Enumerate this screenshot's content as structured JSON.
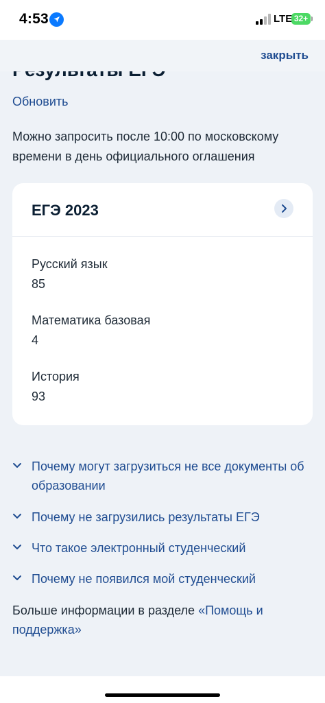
{
  "status_bar": {
    "time": "4:53",
    "network": "LTE",
    "battery": "32+",
    "icons": [
      "location-arrow-icon",
      "signal-icon",
      "battery-icon"
    ]
  },
  "nav": {
    "close_label": "закрыть"
  },
  "header": {
    "title": "Результаты ЕГЭ",
    "refresh_label": "Обновить"
  },
  "note": "Можно запросить после 10:00 по московскому времени в день официального оглашения",
  "exam_card": {
    "title": "ЕГЭ 2023",
    "subjects": [
      {
        "name": "Русский язык",
        "score": "85"
      },
      {
        "name": "Математика базовая",
        "score": "4"
      },
      {
        "name": "История",
        "score": "93"
      }
    ]
  },
  "faq": [
    {
      "question": "Почему могут загрузиться не все документы об образовании"
    },
    {
      "question": "Почему не загрузились результаты ЕГЭ"
    },
    {
      "question": "Что такое электронный студенческий"
    },
    {
      "question": "Почему не появился мой студенческий"
    }
  ],
  "more_info": {
    "prefix": "Больше информации в разделе ",
    "link": "«Помощь и поддержка»"
  },
  "colors": {
    "accent": "#1f4c91",
    "page_background": "#eef2f7",
    "card_background": "#ffffff",
    "battery": "#4cd964"
  }
}
